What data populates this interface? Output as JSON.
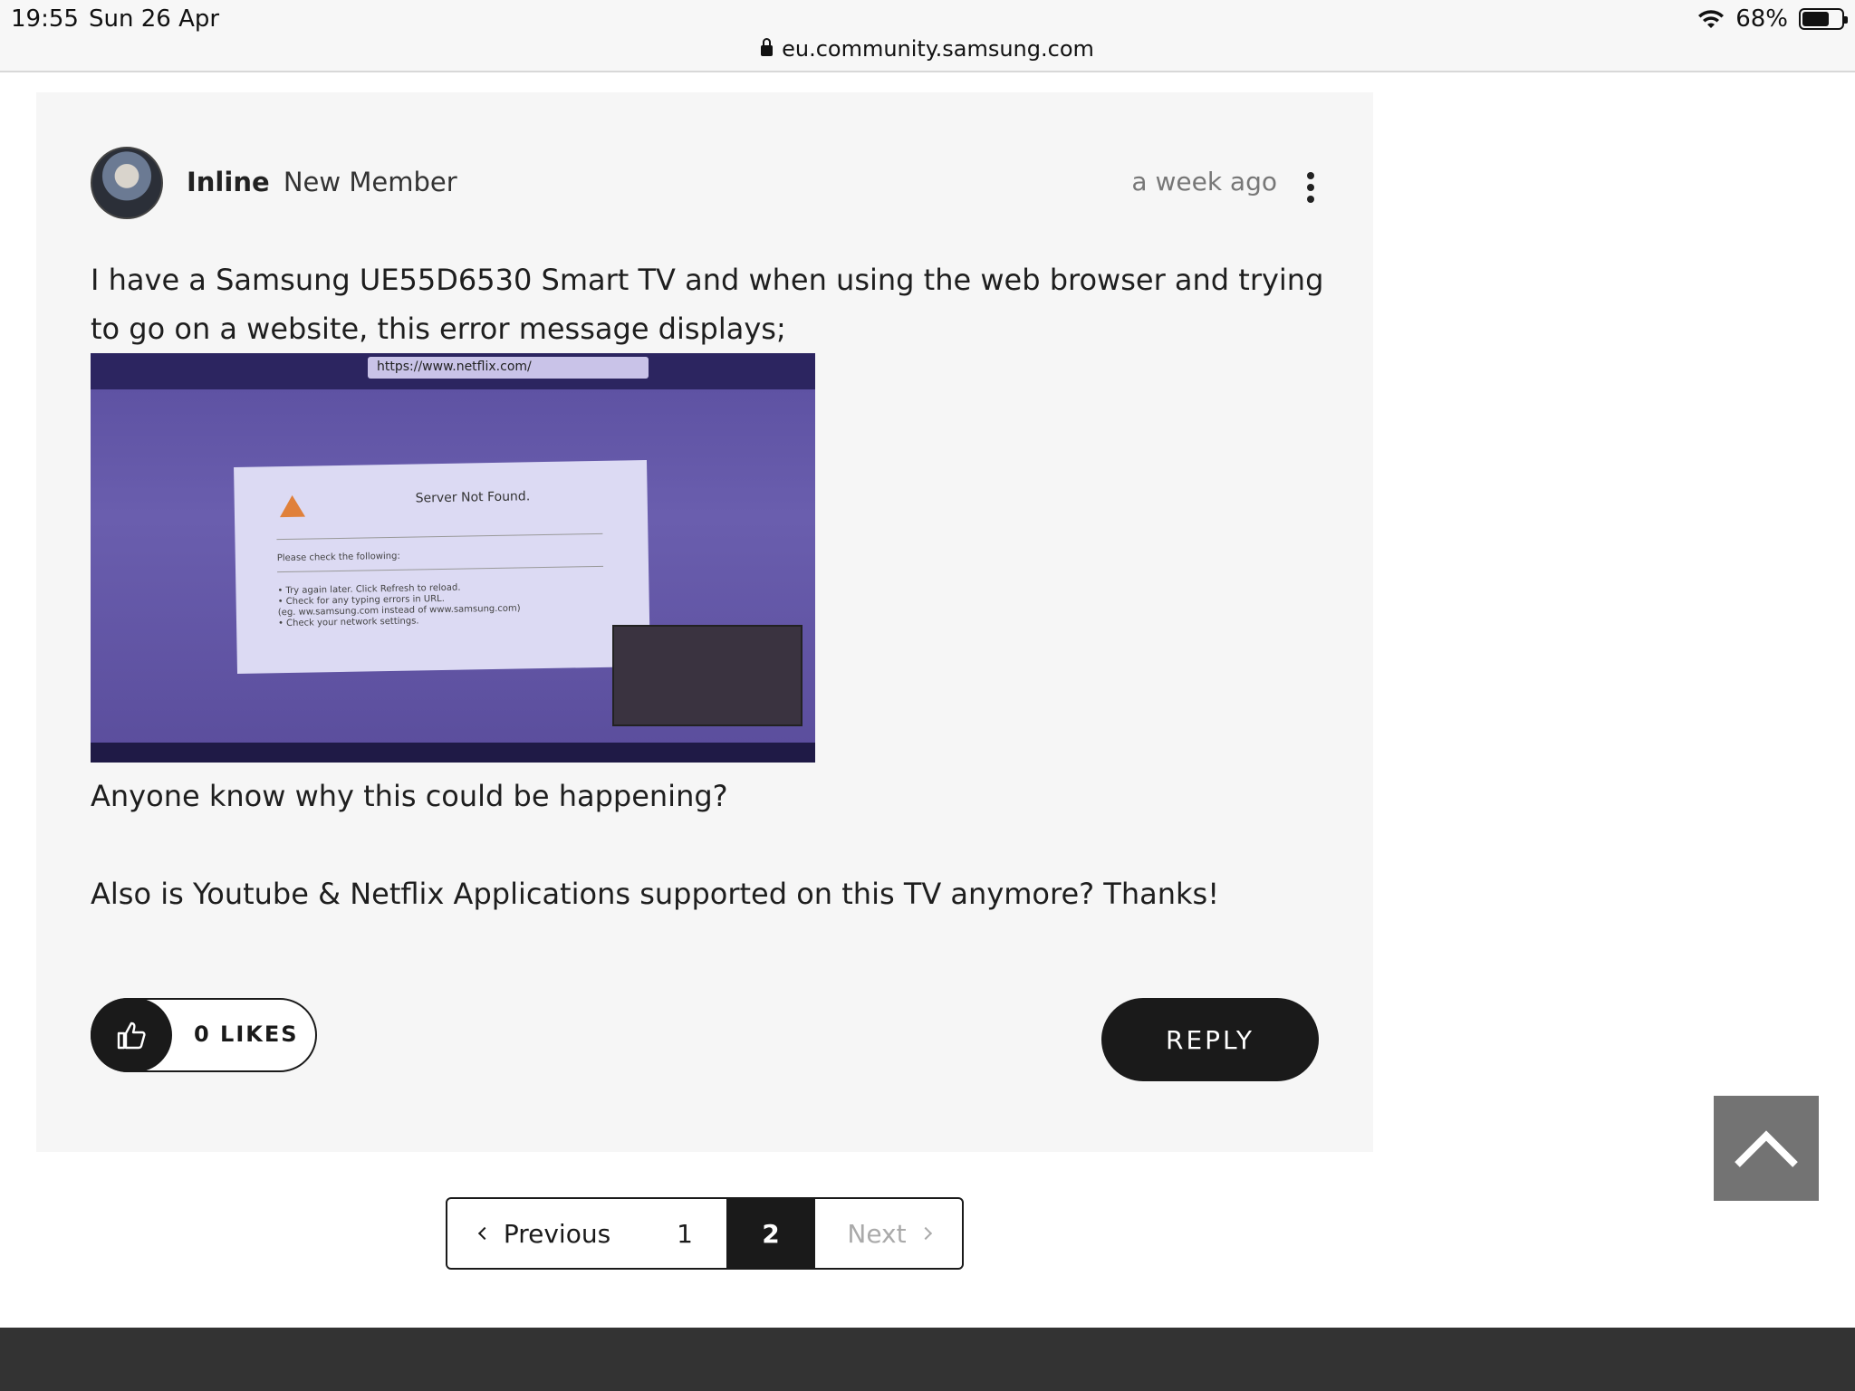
{
  "status_bar": {
    "time": "19:55",
    "date": "Sun 26 Apr",
    "battery_percent": "68%",
    "battery_level": 0.68,
    "url": "eu.community.samsung.com"
  },
  "post": {
    "author_name": "Inline",
    "author_rank": "New Member",
    "timestamp": "a week ago",
    "body_intro": "I have a Samsung UE55D6530 Smart TV and when using the web browser and trying to go on a website, this error message displays;",
    "image": {
      "tv_url": "https://www.netflix.com/",
      "dialog_title": "Server Not Found.",
      "dialog_subtitle": "Please check the following:",
      "bullets": [
        "• Try again later. Click Refresh to reload.",
        "• Check for any typing errors in URL.",
        "(eg. ww.samsung.com instead of www.samsung.com)",
        "• Check your network settings."
      ]
    },
    "question": "Anyone know why this could be happening?",
    "followup": "Also is Youtube & Netflix Applications supported on this TV anymore? Thanks!",
    "likes_label": "0 LIKES",
    "reply_label": "REPLY"
  },
  "pagination": {
    "previous_label": "Previous",
    "page_1": "1",
    "page_2": "2",
    "next_label": "Next",
    "current_page": 2
  },
  "icons": {
    "wifi": "wifi-icon",
    "lock": "lock-icon",
    "more": "more-vertical-icon",
    "thumb": "thumbs-up-icon",
    "back_to_top": "chevron-up-icon"
  }
}
